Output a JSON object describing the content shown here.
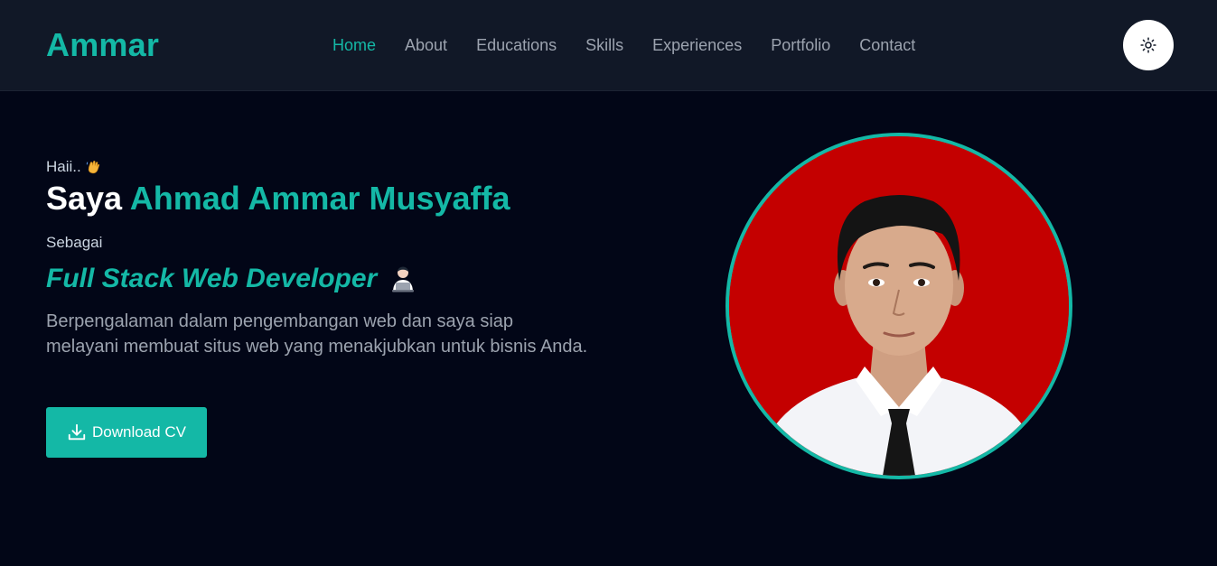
{
  "header": {
    "logo": "Ammar",
    "nav": [
      {
        "label": "Home",
        "active": true
      },
      {
        "label": "About",
        "active": false
      },
      {
        "label": "Educations",
        "active": false
      },
      {
        "label": "Skills",
        "active": false
      },
      {
        "label": "Experiences",
        "active": false
      },
      {
        "label": "Portfolio",
        "active": false
      },
      {
        "label": "Contact",
        "active": false
      }
    ],
    "theme_toggle_icon": "sun-icon"
  },
  "hero": {
    "greeting": "Haii..",
    "greeting_icon": "waving-hand-icon",
    "headline_prefix": "Saya",
    "headline_name": "Ahmad Ammar Musyaffa",
    "sebagai": "Sebagai",
    "role": "Full Stack Web Developer",
    "role_icon": "technologist-icon",
    "description": "Berpengalaman dalam pengembangan web dan saya siap melayani membuat situs web yang menakjubkan untuk bisnis Anda.",
    "cv_button_label": "Download CV",
    "cv_button_icon": "download-icon",
    "photo": "profile-photo"
  },
  "colors": {
    "accent": "#14b8a6",
    "background": "#020617",
    "navbar": "#111827",
    "photo_background": "#c40000"
  }
}
